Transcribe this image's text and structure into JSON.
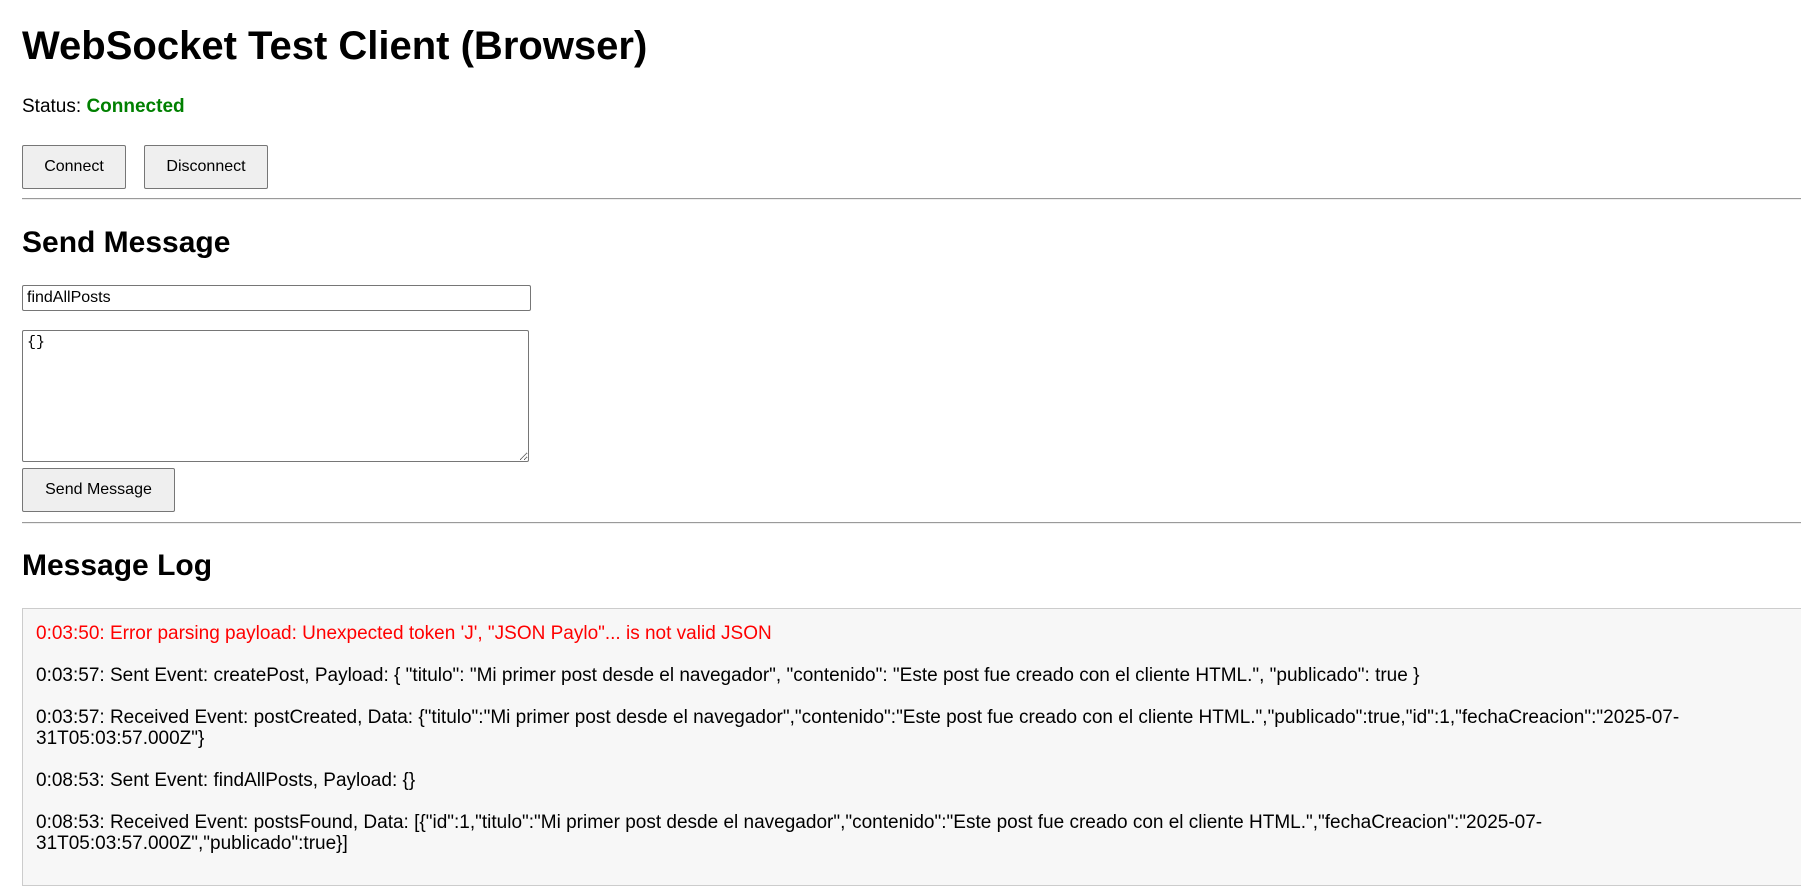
{
  "page": {
    "title": "WebSocket Test Client (Browser)"
  },
  "status": {
    "label": "Status:",
    "value": "Connected",
    "color": "#008000"
  },
  "controls": {
    "connect_label": "Connect",
    "disconnect_label": "Disconnect"
  },
  "send": {
    "heading": "Send Message",
    "event_value": "findAllPosts",
    "payload_value": "{}",
    "button_label": "Send Message"
  },
  "log": {
    "heading": "Message Log",
    "error_color": "#ff0000",
    "entries": [
      {
        "type": "error",
        "text": "0:03:50: Error parsing payload: Unexpected token 'J', \"JSON Paylo\"... is not valid JSON"
      },
      {
        "type": "sent",
        "text": "0:03:57: Sent Event: createPost, Payload: { \"titulo\": \"Mi primer post desde el navegador\", \"contenido\": \"Este post fue creado con el cliente HTML.\", \"publicado\": true }"
      },
      {
        "type": "received",
        "text": "0:03:57: Received Event: postCreated, Data: {\"titulo\":\"Mi primer post desde el navegador\",\"contenido\":\"Este post fue creado con el cliente HTML.\",\"publicado\":true,\"id\":1,\"fechaCreacion\":\"2025-07-31T05:03:57.000Z\"}"
      },
      {
        "type": "sent",
        "text": "0:08:53: Sent Event: findAllPosts, Payload: {}"
      },
      {
        "type": "received",
        "text": "0:08:53: Received Event: postsFound, Data: [{\"id\":1,\"titulo\":\"Mi primer post desde el navegador\",\"contenido\":\"Este post fue creado con el cliente HTML.\",\"fechaCreacion\":\"2025-07-31T05:03:57.000Z\",\"publicado\":true}]"
      }
    ]
  }
}
